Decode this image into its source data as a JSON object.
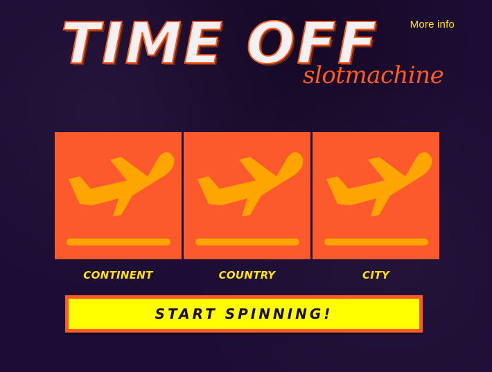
{
  "header": {
    "title": "TIME OFF",
    "subtitle": "slotmachine",
    "more_info_label": "More info"
  },
  "reels": [
    {
      "icon": "airplane-takeoff-icon",
      "label": "CONTINENT"
    },
    {
      "icon": "airplane-takeoff-icon",
      "label": "COUNTRY"
    },
    {
      "icon": "airplane-takeoff-icon",
      "label": "CITY"
    }
  ],
  "controls": {
    "start_label": "START SPINNING!"
  },
  "colors": {
    "background": "#1d0c33",
    "reel": "#fc5a2c",
    "icon": "#ffa500",
    "accent_yellow": "#ffff00",
    "label_yellow": "#ffe600",
    "title_outline": "#ff5a1f"
  }
}
